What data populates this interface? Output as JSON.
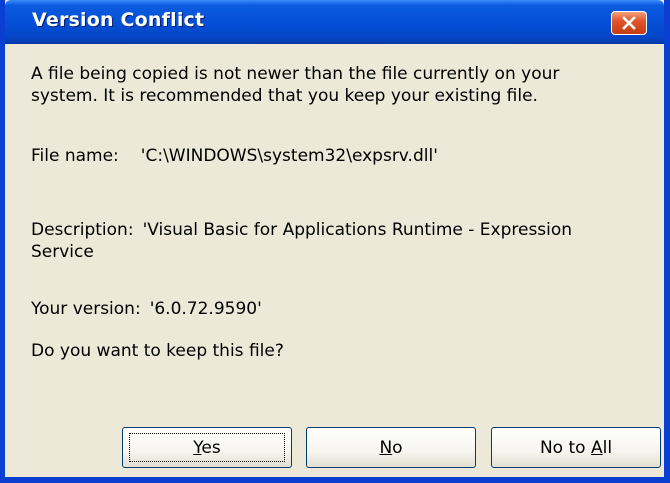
{
  "dialog": {
    "title": "Version Conflict",
    "message_line1": "A file being copied is not newer than the file currently on your",
    "message_line2": "system. It is recommended that you keep your existing file.",
    "file_name_label": "File name:",
    "file_name_value": "'C:\\WINDOWS\\system32\\expsrv.dll'",
    "description_label": "Description:",
    "description_value_line1": "'Visual Basic for Applications Runtime - Expression",
    "description_value_line2": "Service",
    "version_label": "Your version:",
    "version_value": "'6.0.72.9590'",
    "question": "Do you want to keep this file?"
  },
  "buttons": {
    "yes": {
      "pre": "",
      "accel": "Y",
      "post": "es"
    },
    "no": {
      "pre": "",
      "accel": "N",
      "post": "o"
    },
    "no_to_all": {
      "pre": "No to ",
      "accel": "A",
      "post": "ll"
    }
  },
  "icons": {
    "close": "close-icon"
  },
  "colors": {
    "titlebar": "#0550d8",
    "frame": "#0a3fd1",
    "dialog_bg": "#ece9d8",
    "close_button": "#e1552b"
  }
}
